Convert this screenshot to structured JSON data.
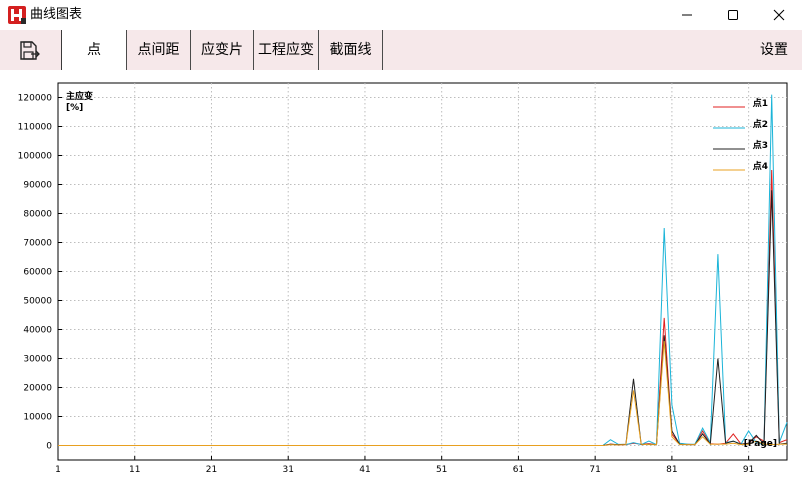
{
  "window": {
    "title": "曲线图表",
    "icon": "app-logo-icon"
  },
  "toolbar": {
    "save_icon": "save-icon",
    "tabs": [
      "点",
      "点间距",
      "应变片",
      "工程应变",
      "截面线"
    ],
    "active_tab": "点",
    "settings_label": "设置"
  },
  "chart_data": {
    "type": "line",
    "ylabel_line1": "主应变",
    "ylabel_line2": "[%]",
    "xlabel": "[Page]",
    "grid": true,
    "legend_position": "top-right",
    "xlim": [
      1,
      96
    ],
    "ylim": [
      -5000,
      125000
    ],
    "x_ticks": [
      1,
      11,
      21,
      31,
      41,
      51,
      61,
      71,
      81,
      91
    ],
    "y_ticks": [
      0,
      10000,
      20000,
      30000,
      40000,
      50000,
      60000,
      70000,
      80000,
      90000,
      100000,
      110000,
      120000
    ],
    "series": [
      {
        "name": "点1",
        "color": "#e02020",
        "points": [
          [
            1,
            0
          ],
          [
            72,
            0
          ],
          [
            73,
            500
          ],
          [
            74,
            200
          ],
          [
            75,
            300
          ],
          [
            76,
            800
          ],
          [
            77,
            400
          ],
          [
            78,
            600
          ],
          [
            79,
            300
          ],
          [
            80,
            44000
          ],
          [
            81,
            4000
          ],
          [
            82,
            500
          ],
          [
            83,
            400
          ],
          [
            84,
            300
          ],
          [
            85,
            5000
          ],
          [
            86,
            600
          ],
          [
            87,
            400
          ],
          [
            88,
            800
          ],
          [
            89,
            4000
          ],
          [
            90,
            500
          ],
          [
            91,
            800
          ],
          [
            92,
            3000
          ],
          [
            93,
            1500
          ],
          [
            94,
            95000
          ],
          [
            95,
            1000
          ],
          [
            96,
            2000
          ]
        ]
      },
      {
        "name": "点2",
        "color": "#1ab4d8",
        "points": [
          [
            1,
            0
          ],
          [
            72,
            0
          ],
          [
            73,
            2000
          ],
          [
            74,
            400
          ],
          [
            75,
            300
          ],
          [
            76,
            1000
          ],
          [
            77,
            300
          ],
          [
            78,
            1500
          ],
          [
            79,
            300
          ],
          [
            80,
            75000
          ],
          [
            81,
            14000
          ],
          [
            82,
            800
          ],
          [
            83,
            500
          ],
          [
            84,
            400
          ],
          [
            85,
            6000
          ],
          [
            86,
            1000
          ],
          [
            87,
            66000
          ],
          [
            88,
            1000
          ],
          [
            89,
            1500
          ],
          [
            90,
            500
          ],
          [
            91,
            5000
          ],
          [
            92,
            1000
          ],
          [
            93,
            300
          ],
          [
            94,
            121000
          ],
          [
            95,
            1000
          ],
          [
            96,
            8000
          ]
        ]
      },
      {
        "name": "点3",
        "color": "#202020",
        "points": [
          [
            1,
            0
          ],
          [
            72,
            0
          ],
          [
            73,
            400
          ],
          [
            74,
            300
          ],
          [
            75,
            400
          ],
          [
            76,
            23000
          ],
          [
            77,
            300
          ],
          [
            78,
            400
          ],
          [
            79,
            300
          ],
          [
            80,
            38000
          ],
          [
            81,
            5000
          ],
          [
            82,
            400
          ],
          [
            83,
            300
          ],
          [
            84,
            300
          ],
          [
            85,
            4000
          ],
          [
            86,
            500
          ],
          [
            87,
            30000
          ],
          [
            88,
            800
          ],
          [
            89,
            1500
          ],
          [
            90,
            400
          ],
          [
            91,
            800
          ],
          [
            92,
            3500
          ],
          [
            93,
            500
          ],
          [
            94,
            88000
          ],
          [
            95,
            500
          ],
          [
            96,
            800
          ]
        ]
      },
      {
        "name": "点4",
        "color": "#e8a020",
        "points": [
          [
            1,
            0
          ],
          [
            72,
            0
          ],
          [
            73,
            300
          ],
          [
            74,
            200
          ],
          [
            75,
            300
          ],
          [
            76,
            19000
          ],
          [
            77,
            400
          ],
          [
            78,
            300
          ],
          [
            79,
            300
          ],
          [
            80,
            36000
          ],
          [
            81,
            3000
          ],
          [
            82,
            300
          ],
          [
            83,
            300
          ],
          [
            84,
            300
          ],
          [
            85,
            3000
          ],
          [
            86,
            400
          ],
          [
            87,
            500
          ],
          [
            88,
            500
          ],
          [
            89,
            800
          ],
          [
            90,
            300
          ],
          [
            91,
            400
          ],
          [
            92,
            1500
          ],
          [
            93,
            500
          ],
          [
            94,
            300
          ],
          [
            95,
            400
          ],
          [
            96,
            500
          ]
        ]
      }
    ]
  }
}
